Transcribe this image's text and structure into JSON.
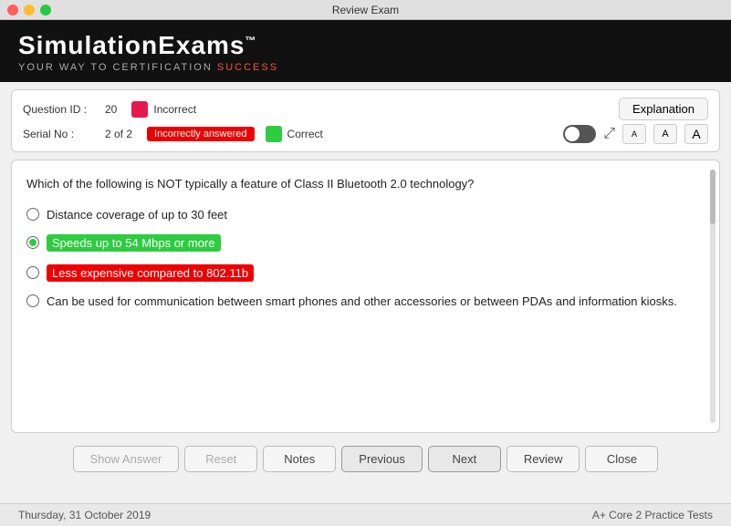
{
  "titleBar": {
    "title": "Review Exam"
  },
  "brand": {
    "title": "SimulationExams",
    "tm": "™",
    "subtitle_before": "YOUR ",
    "subtitle_way": "WAY",
    "subtitle_middle": " TO CERTIFICATION ",
    "subtitle_success": "SUCCESS"
  },
  "infoBar": {
    "questionIdLabel": "Question ID :",
    "questionIdValue": "20",
    "serialNoLabel": "Serial No :",
    "serialNoValue": "2 of 2",
    "incorrectlyAnsweredLabel": "Incorrectly answered",
    "incorrectLabel": "Incorrect",
    "correctLabel": "Correct",
    "explanationLabel": "Explanation",
    "fontSmall": "A",
    "fontMedium": "A",
    "fontLarge": "A"
  },
  "question": {
    "text": "Which of the following is NOT typically a feature of Class II Bluetooth 2.0 technology?",
    "options": [
      {
        "id": "a",
        "text": "Distance coverage of up to 30 feet",
        "state": "normal"
      },
      {
        "id": "b",
        "text": "Speeds up to 54 Mbps or more",
        "state": "correct"
      },
      {
        "id": "c",
        "text": "Less expensive compared to 802.11b",
        "state": "incorrect"
      },
      {
        "id": "d",
        "text": "Can be used for communication between smart phones and other accessories or between PDAs and information kiosks.",
        "state": "normal"
      }
    ]
  },
  "buttons": {
    "showAnswer": "Show Answer",
    "reset": "Reset",
    "notes": "Notes",
    "previous": "Previous",
    "next": "Next",
    "review": "Review",
    "close": "Close"
  },
  "footer": {
    "date": "Thursday, 31 October 2019",
    "product": "A+ Core 2 Practice Tests"
  }
}
